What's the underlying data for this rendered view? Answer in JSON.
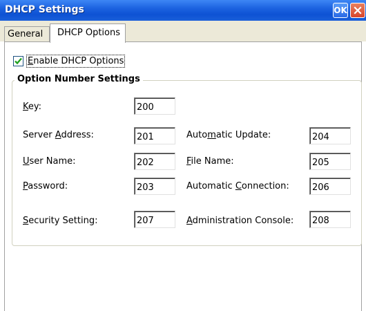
{
  "window": {
    "title": "DHCP Settings",
    "ok_label": "OK"
  },
  "tabs": [
    {
      "label": "General",
      "selected": false
    },
    {
      "label": "DHCP Options",
      "selected": true
    }
  ],
  "enable_option": {
    "label_access": "E",
    "label_rest": "nable DHCP Options",
    "checked": true
  },
  "group": {
    "title": "Option Number Settings"
  },
  "fields": {
    "key": {
      "pre": "",
      "acc": "K",
      "post": "ey:",
      "value": "200"
    },
    "server_address": {
      "pre": "Server ",
      "acc": "A",
      "post": "ddress:",
      "value": "201"
    },
    "user_name": {
      "pre": "",
      "acc": "U",
      "post": "ser Name:",
      "value": "202"
    },
    "password": {
      "pre": "",
      "acc": "P",
      "post": "assword:",
      "value": "203"
    },
    "automatic_update": {
      "pre": "Auto",
      "acc": "m",
      "post": "atic Update:",
      "value": "204"
    },
    "file_name": {
      "pre": "",
      "acc": "F",
      "post": "ile Name:",
      "value": "205"
    },
    "automatic_connection": {
      "pre": "Automatic ",
      "acc": "C",
      "post": "onnection:",
      "value": "206"
    },
    "security_setting": {
      "pre": "",
      "acc": "S",
      "post": "ecurity Setting:",
      "value": "207"
    },
    "administration_console": {
      "pre": "",
      "acc": "A",
      "post": "dministration Console:",
      "value": "208"
    }
  },
  "colors": {
    "titlebar": "#0d52d4",
    "tab_background": "#ece9d8",
    "checkmark": "#21a121",
    "close_button": "#d8442b"
  }
}
